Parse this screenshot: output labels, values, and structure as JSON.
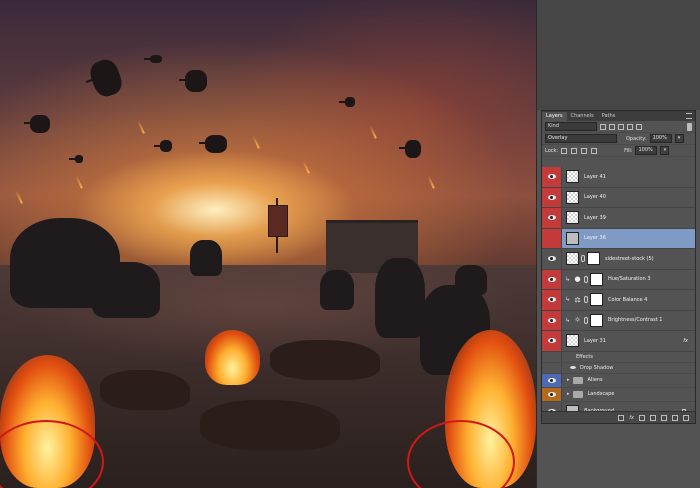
{
  "panel": {
    "tabs": [
      "Layers",
      "Channels",
      "Paths"
    ],
    "filter_kind": "Kind",
    "blend_mode": "Overlay",
    "opacity_label": "Opacity:",
    "opacity_value": "100%",
    "lock_label": "Lock:",
    "fill_label": "Fill:",
    "fill_value": "100%"
  },
  "layers": [
    {
      "name": "Layer 41",
      "tag": "red"
    },
    {
      "name": "Layer 40",
      "tag": "red"
    },
    {
      "name": "Layer 39",
      "tag": "red"
    },
    {
      "name": "Layer 36",
      "tag": "red",
      "selected": true
    },
    {
      "name": "sidestreet-stock (5)",
      "tag": "none"
    },
    {
      "name": "Hue/Saturation 3",
      "tag": "red",
      "icon": "hue-saturation-icon"
    },
    {
      "name": "Color Balance 4",
      "tag": "red",
      "icon": "color-balance-icon"
    },
    {
      "name": "Brightness/Contrast 1",
      "tag": "red",
      "icon": "brightness-icon"
    },
    {
      "name": "Layer 31",
      "tag": "red",
      "fx": "fx"
    }
  ],
  "effects": {
    "label": "Effects",
    "drop_shadow": "Drop Shadow"
  },
  "groups": [
    {
      "name": "Aliens",
      "tag": "blue"
    },
    {
      "name": "Landscape",
      "tag": "orange"
    }
  ],
  "background_layer": {
    "name": "Background"
  },
  "bottom_bar": {
    "fx_label": "fx"
  }
}
